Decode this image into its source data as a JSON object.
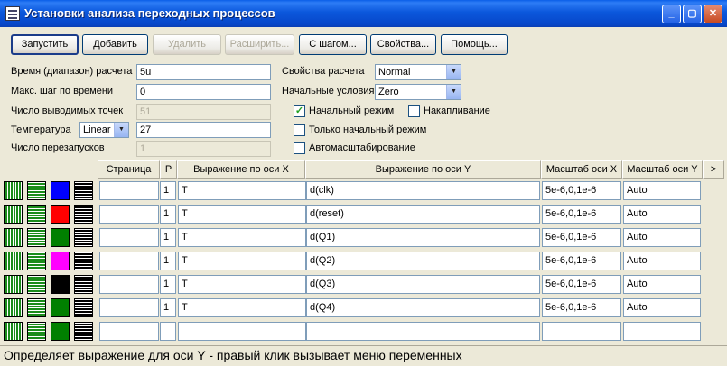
{
  "window": {
    "title": "Установки анализа переходных процессов",
    "controls": [
      "minimize-icon",
      "maximize-icon",
      "close-icon"
    ]
  },
  "toolbar": {
    "run": "Запустить",
    "add": "Добавить",
    "delete": "Удалить",
    "expand": "Расширить...",
    "step": "С шагом...",
    "properties": "Свойства...",
    "help": "Помощь..."
  },
  "params": {
    "time_label": "Время (диапазон) расчета",
    "time_value": "5u",
    "maxstep_label": "Макс.  шаг по времени",
    "maxstep_value": "0",
    "points_label": "Число выводимых точек",
    "points_value": "51",
    "temp_label": "Температура",
    "temp_mode": "Linear",
    "temp_value": "27",
    "restarts_label": "Число перезапусков",
    "restarts_value": "1"
  },
  "options": {
    "calc_props_label": "Свойства расчета",
    "calc_props_value": "Normal",
    "init_cond_label": "Начальные условия",
    "init_cond_value": "Zero",
    "initial_mode_label": "Начальный режим",
    "initial_mode_checked": true,
    "accumulate_label": "Накапливание",
    "accumulate_checked": false,
    "only_initial_label": "Только начальный режим",
    "only_initial_checked": false,
    "autoscale_label": "Автомасштабирование",
    "autoscale_checked": false
  },
  "grid": {
    "headers": {
      "page": "Страница",
      "p": "P",
      "xexpr": "Выражение по оси X",
      "yexpr": "Выражение по оси Y",
      "xscale": "Масштаб оси X",
      "yscale": "Масштаб оси Y",
      "more": ">"
    },
    "rows": [
      {
        "color": "#0000ff",
        "page": "",
        "p": "1",
        "x": "T",
        "y": "d(clk)",
        "xscale": "5e-6,0,1e-6",
        "yscale": "Auto"
      },
      {
        "color": "#ff0000",
        "page": "",
        "p": "1",
        "x": "T",
        "y": "d(reset)",
        "xscale": "5e-6,0,1e-6",
        "yscale": "Auto"
      },
      {
        "color": "#008000",
        "page": "",
        "p": "1",
        "x": "T",
        "y": "d(Q1)",
        "xscale": "5e-6,0,1e-6",
        "yscale": "Auto"
      },
      {
        "color": "#ff00ff",
        "page": "",
        "p": "1",
        "x": "T",
        "y": "d(Q2)",
        "xscale": "5e-6,0,1e-6",
        "yscale": "Auto"
      },
      {
        "color": "#000000",
        "page": "",
        "p": "1",
        "x": "T",
        "y": "d(Q3)",
        "xscale": "5e-6,0,1e-6",
        "yscale": "Auto"
      },
      {
        "color": "#008000",
        "page": "",
        "p": "1",
        "x": "T",
        "y": "d(Q4)",
        "xscale": "5e-6,0,1e-6",
        "yscale": "Auto"
      },
      {
        "color": "#008000",
        "page": "",
        "p": "",
        "x": "",
        "y": "",
        "xscale": "",
        "yscale": ""
      }
    ]
  },
  "status": {
    "text": "Определяет выражение для оси Y  - правый клик  вызывает меню переменных"
  }
}
